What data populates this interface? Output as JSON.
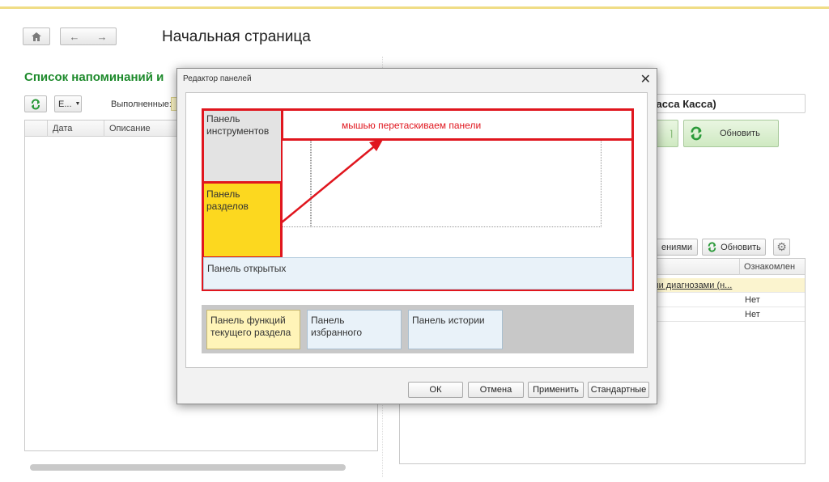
{
  "page": {
    "title": "Начальная страница"
  },
  "reminders": {
    "title": "Список напоминаний и",
    "dropdown_label": "Е...",
    "completed_label": "Выполненные:",
    "columns": [
      "Дата",
      "Описание"
    ]
  },
  "right": {
    "title": "касса Касса)",
    "refresh_label": "Обновить",
    "acquaint_label": "ениями",
    "refresh2_label": "Обновить",
    "column_ack": "Ознакомлен",
    "row1_text": "ми диагнозами (н...",
    "row2_ack": "Нет",
    "row3_ack": "Нет"
  },
  "dialog": {
    "title": "Редактор панелей",
    "annotation": "мышью перетаскиваем панели",
    "panel_tools": "Панель инструментов",
    "panel_sections": "Панель разделов",
    "panel_open": "Панель открытых",
    "panel_functions": "Панель функций текущего раздела",
    "panel_favorites": "Панель избранного",
    "panel_history": "Панель истории",
    "buttons": {
      "ok": "ОК",
      "cancel": "Отмена",
      "apply": "Применить",
      "standard": "Стандартные"
    }
  },
  "colors": {
    "accent_red": "#e0161e",
    "sections_yellow": "#fcd81f",
    "title_green": "#1e8a2c"
  }
}
